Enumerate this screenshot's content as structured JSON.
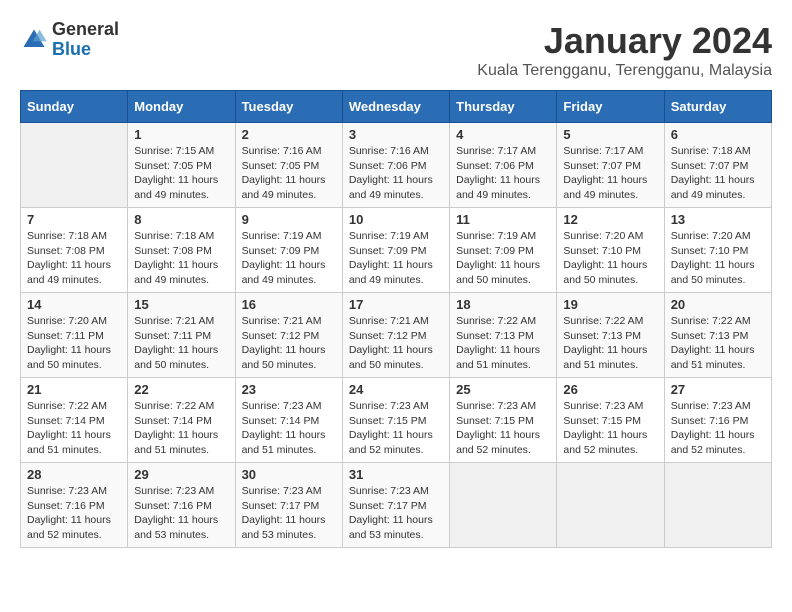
{
  "header": {
    "logo_general": "General",
    "logo_blue": "Blue",
    "month_title": "January 2024",
    "subtitle": "Kuala Terengganu, Terengganu, Malaysia"
  },
  "weekdays": [
    "Sunday",
    "Monday",
    "Tuesday",
    "Wednesday",
    "Thursday",
    "Friday",
    "Saturday"
  ],
  "weeks": [
    [
      {
        "day": "",
        "info": ""
      },
      {
        "day": "1",
        "info": "Sunrise: 7:15 AM\nSunset: 7:05 PM\nDaylight: 11 hours\nand 49 minutes."
      },
      {
        "day": "2",
        "info": "Sunrise: 7:16 AM\nSunset: 7:05 PM\nDaylight: 11 hours\nand 49 minutes."
      },
      {
        "day": "3",
        "info": "Sunrise: 7:16 AM\nSunset: 7:06 PM\nDaylight: 11 hours\nand 49 minutes."
      },
      {
        "day": "4",
        "info": "Sunrise: 7:17 AM\nSunset: 7:06 PM\nDaylight: 11 hours\nand 49 minutes."
      },
      {
        "day": "5",
        "info": "Sunrise: 7:17 AM\nSunset: 7:07 PM\nDaylight: 11 hours\nand 49 minutes."
      },
      {
        "day": "6",
        "info": "Sunrise: 7:18 AM\nSunset: 7:07 PM\nDaylight: 11 hours\nand 49 minutes."
      }
    ],
    [
      {
        "day": "7",
        "info": "Sunrise: 7:18 AM\nSunset: 7:08 PM\nDaylight: 11 hours\nand 49 minutes."
      },
      {
        "day": "8",
        "info": "Sunrise: 7:18 AM\nSunset: 7:08 PM\nDaylight: 11 hours\nand 49 minutes."
      },
      {
        "day": "9",
        "info": "Sunrise: 7:19 AM\nSunset: 7:09 PM\nDaylight: 11 hours\nand 49 minutes."
      },
      {
        "day": "10",
        "info": "Sunrise: 7:19 AM\nSunset: 7:09 PM\nDaylight: 11 hours\nand 49 minutes."
      },
      {
        "day": "11",
        "info": "Sunrise: 7:19 AM\nSunset: 7:09 PM\nDaylight: 11 hours\nand 50 minutes."
      },
      {
        "day": "12",
        "info": "Sunrise: 7:20 AM\nSunset: 7:10 PM\nDaylight: 11 hours\nand 50 minutes."
      },
      {
        "day": "13",
        "info": "Sunrise: 7:20 AM\nSunset: 7:10 PM\nDaylight: 11 hours\nand 50 minutes."
      }
    ],
    [
      {
        "day": "14",
        "info": "Sunrise: 7:20 AM\nSunset: 7:11 PM\nDaylight: 11 hours\nand 50 minutes."
      },
      {
        "day": "15",
        "info": "Sunrise: 7:21 AM\nSunset: 7:11 PM\nDaylight: 11 hours\nand 50 minutes."
      },
      {
        "day": "16",
        "info": "Sunrise: 7:21 AM\nSunset: 7:12 PM\nDaylight: 11 hours\nand 50 minutes."
      },
      {
        "day": "17",
        "info": "Sunrise: 7:21 AM\nSunset: 7:12 PM\nDaylight: 11 hours\nand 50 minutes."
      },
      {
        "day": "18",
        "info": "Sunrise: 7:22 AM\nSunset: 7:13 PM\nDaylight: 11 hours\nand 51 minutes."
      },
      {
        "day": "19",
        "info": "Sunrise: 7:22 AM\nSunset: 7:13 PM\nDaylight: 11 hours\nand 51 minutes."
      },
      {
        "day": "20",
        "info": "Sunrise: 7:22 AM\nSunset: 7:13 PM\nDaylight: 11 hours\nand 51 minutes."
      }
    ],
    [
      {
        "day": "21",
        "info": "Sunrise: 7:22 AM\nSunset: 7:14 PM\nDaylight: 11 hours\nand 51 minutes."
      },
      {
        "day": "22",
        "info": "Sunrise: 7:22 AM\nSunset: 7:14 PM\nDaylight: 11 hours\nand 51 minutes."
      },
      {
        "day": "23",
        "info": "Sunrise: 7:23 AM\nSunset: 7:14 PM\nDaylight: 11 hours\nand 51 minutes."
      },
      {
        "day": "24",
        "info": "Sunrise: 7:23 AM\nSunset: 7:15 PM\nDaylight: 11 hours\nand 52 minutes."
      },
      {
        "day": "25",
        "info": "Sunrise: 7:23 AM\nSunset: 7:15 PM\nDaylight: 11 hours\nand 52 minutes."
      },
      {
        "day": "26",
        "info": "Sunrise: 7:23 AM\nSunset: 7:15 PM\nDaylight: 11 hours\nand 52 minutes."
      },
      {
        "day": "27",
        "info": "Sunrise: 7:23 AM\nSunset: 7:16 PM\nDaylight: 11 hours\nand 52 minutes."
      }
    ],
    [
      {
        "day": "28",
        "info": "Sunrise: 7:23 AM\nSunset: 7:16 PM\nDaylight: 11 hours\nand 52 minutes."
      },
      {
        "day": "29",
        "info": "Sunrise: 7:23 AM\nSunset: 7:16 PM\nDaylight: 11 hours\nand 53 minutes."
      },
      {
        "day": "30",
        "info": "Sunrise: 7:23 AM\nSunset: 7:17 PM\nDaylight: 11 hours\nand 53 minutes."
      },
      {
        "day": "31",
        "info": "Sunrise: 7:23 AM\nSunset: 7:17 PM\nDaylight: 11 hours\nand 53 minutes."
      },
      {
        "day": "",
        "info": ""
      },
      {
        "day": "",
        "info": ""
      },
      {
        "day": "",
        "info": ""
      }
    ]
  ]
}
